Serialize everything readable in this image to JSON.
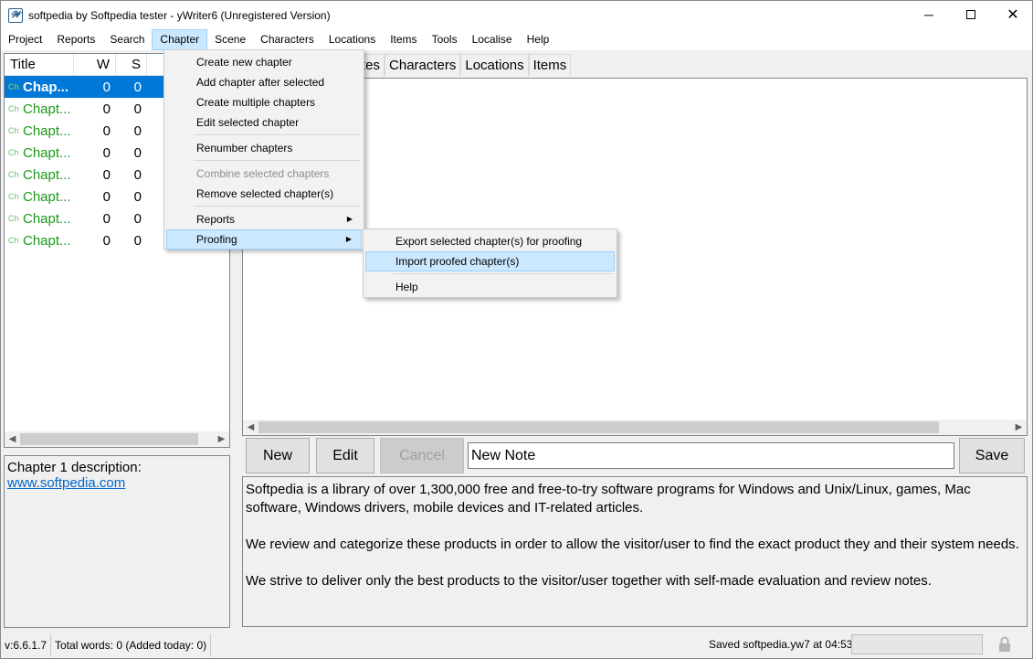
{
  "window": {
    "title": "softpedia by Softpedia tester - yWriter6 (Unregistered Version)",
    "min_glyph": "─",
    "close_glyph": "✕"
  },
  "menubar": [
    "Project",
    "Reports",
    "Search",
    "Chapter",
    "Scene",
    "Characters",
    "Locations",
    "Items",
    "Tools",
    "Localise",
    "Help"
  ],
  "chapter_list": {
    "headers": {
      "title": "Title",
      "w": "W",
      "s": "S"
    },
    "rows": [
      {
        "icon": "Ch",
        "title": "Chap...",
        "w": "0",
        "s": "0"
      },
      {
        "icon": "Ch",
        "title": "Chapt...",
        "w": "0",
        "s": "0"
      },
      {
        "icon": "Ch",
        "title": "Chapt...",
        "w": "0",
        "s": "0"
      },
      {
        "icon": "Ch",
        "title": "Chapt...",
        "w": "0",
        "s": "0"
      },
      {
        "icon": "Ch",
        "title": "Chapt...",
        "w": "0",
        "s": "0"
      },
      {
        "icon": "Ch",
        "title": "Chapt...",
        "w": "0",
        "s": "0"
      },
      {
        "icon": "Ch",
        "title": "Chapt...",
        "w": "0",
        "s": "0"
      },
      {
        "icon": "Ch",
        "title": "Chapt...",
        "w": "0",
        "s": "0"
      }
    ]
  },
  "description": {
    "label": "Chapter 1 description:",
    "link": "www.softpedia.com"
  },
  "tabs": [
    "tes",
    "Characters",
    "Locations",
    "Items"
  ],
  "buttons": {
    "new": "New",
    "edit": "Edit",
    "cancel": "Cancel",
    "save": "Save"
  },
  "note_input": {
    "value": "New Note"
  },
  "body_text": [
    "Softpedia is a library of over 1,300,000 free and free-to-try software programs for Windows and Unix/Linux, games, Mac software, Windows drivers, mobile devices and IT-related articles.",
    "We review and categorize these products in order to allow the visitor/user to find the exact product they and their system needs.",
    "We strive to deliver only the best products to the visitor/user together with self-made evaluation and review notes."
  ],
  "statusbar": {
    "version": "v:6.6.1.7",
    "words": "Total words: 0 (Added today: 0)",
    "saved": "Saved softpedia.yw7 at 04:53"
  },
  "chapter_menu": {
    "create_new": "Create new chapter",
    "add_after": "Add chapter after selected",
    "create_multiple": "Create multiple chapters",
    "edit_selected": "Edit selected chapter",
    "renumber": "Renumber chapters",
    "combine": "Combine selected chapters",
    "remove": "Remove selected chapter(s)",
    "reports": "Reports",
    "proofing": "Proofing"
  },
  "proofing_submenu": {
    "export": "Export selected chapter(s) for proofing",
    "import": "Import proofed chapter(s)",
    "help": "Help"
  },
  "colors": {
    "selection": "#0078d7",
    "chapter_text": "#1a9a1a",
    "menu_hover": "#cce8ff",
    "link": "#0066cc"
  }
}
